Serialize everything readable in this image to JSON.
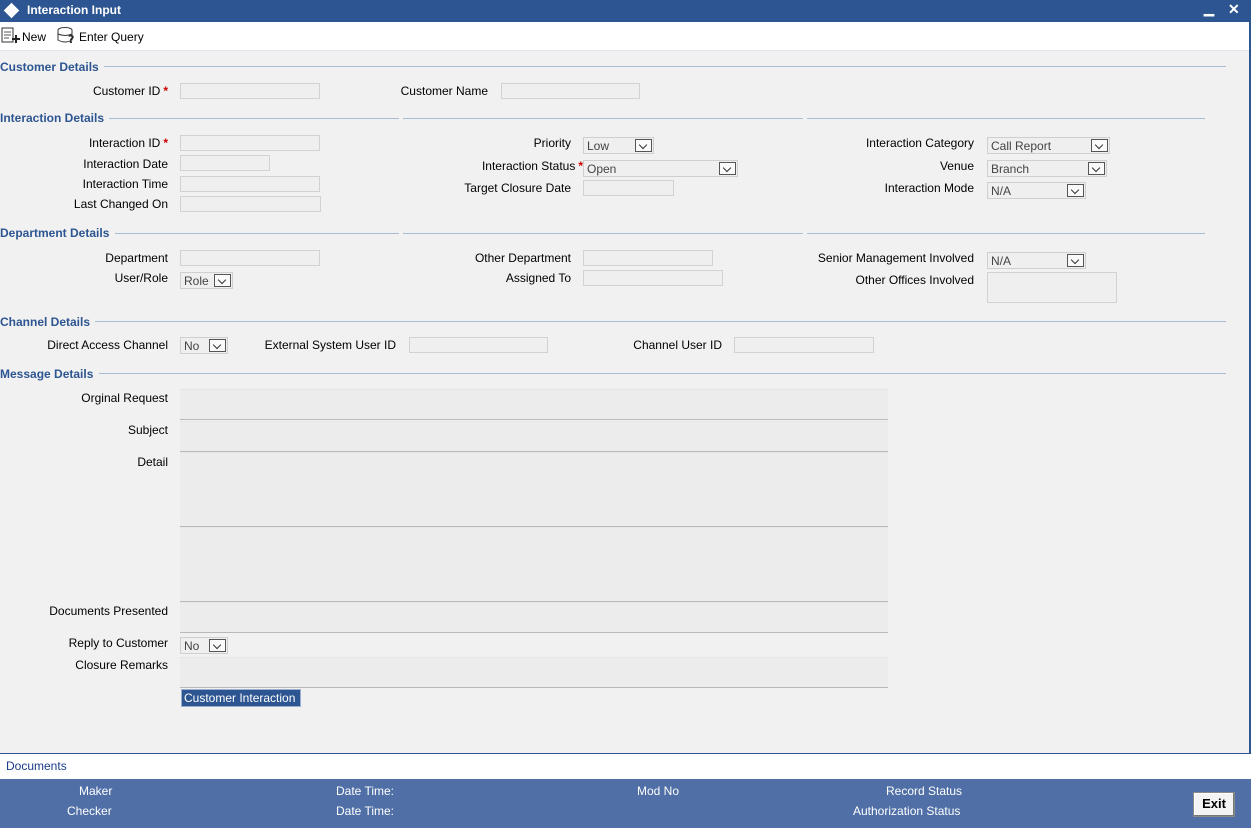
{
  "window": {
    "title": "Interaction Input",
    "minimize": "▁",
    "close": "✕"
  },
  "toolbar": {
    "new_label": "New",
    "enter_query_label": "Enter Query"
  },
  "sections": {
    "customer": "Customer Details",
    "interaction": "Interaction Details",
    "department": "Department Details",
    "channel": "Channel Details",
    "message": "Message Details"
  },
  "customer": {
    "id_label": "Customer ID",
    "id_value": "",
    "name_label": "Customer Name",
    "name_value": ""
  },
  "interaction": {
    "id_label": "Interaction ID",
    "date_label": "Interaction Date",
    "time_label": "Interaction Time",
    "last_changed_label": "Last Changed On",
    "priority_label": "Priority",
    "priority_value": "Low",
    "status_label": "Interaction Status",
    "status_value": "Open",
    "target_closure_label": "Target Closure Date",
    "category_label": "Interaction Category",
    "category_value": "Call Report",
    "venue_label": "Venue",
    "venue_value": "Branch",
    "mode_label": "Interaction Mode",
    "mode_value": "N/A"
  },
  "department": {
    "department_label": "Department",
    "user_role_label": "User/Role",
    "user_role_value": "Role",
    "other_department_label": "Other Department",
    "assigned_to_label": "Assigned To",
    "senior_mgmt_label": "Senior Management Involved",
    "senior_mgmt_value": "N/A",
    "other_offices_label": "Other Offices Involved"
  },
  "channel": {
    "direct_access_label": "Direct Access Channel",
    "direct_access_value": "No",
    "external_user_label": "External System User ID",
    "channel_user_label": "Channel User ID"
  },
  "message": {
    "original_request_label": "Orginal Request",
    "subject_label": "Subject",
    "detail_label": "Detail",
    "documents_presented_label": "Documents Presented",
    "reply_label": "Reply to Customer",
    "reply_value": "No",
    "closure_remarks_label": "Closure Remarks",
    "customer_interaction_button": "Customer Interaction"
  },
  "footer": {
    "documents_link": "Documents",
    "maker": "Maker",
    "checker": "Checker",
    "date_time_1": "Date Time:",
    "date_time_2": "Date Time:",
    "mod_no": "Mod No",
    "record_status": "Record Status",
    "authorization_status": "Authorization Status",
    "exit_label": "Exit"
  },
  "colors": {
    "accent": "#2d5591",
    "status_bar": "#4f6fa6",
    "required": "#cc0000"
  }
}
